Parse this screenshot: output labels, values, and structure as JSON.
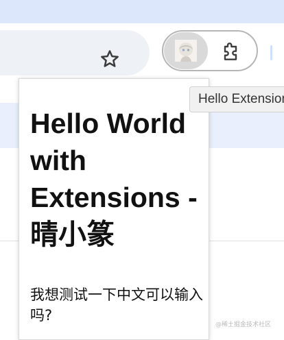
{
  "toolbar": {
    "bookmark_icon": "star-icon",
    "extension_icon": "avatar-icon",
    "extensions_menu_icon": "puzzle-icon"
  },
  "tooltip": {
    "text": "Hello Extensions"
  },
  "popup": {
    "heading": "Hello World with Extensions - 晴小篆",
    "body": "我想测试一下中文可以输入吗?"
  },
  "watermark": {
    "text": "@稀土掘金技术社区"
  }
}
